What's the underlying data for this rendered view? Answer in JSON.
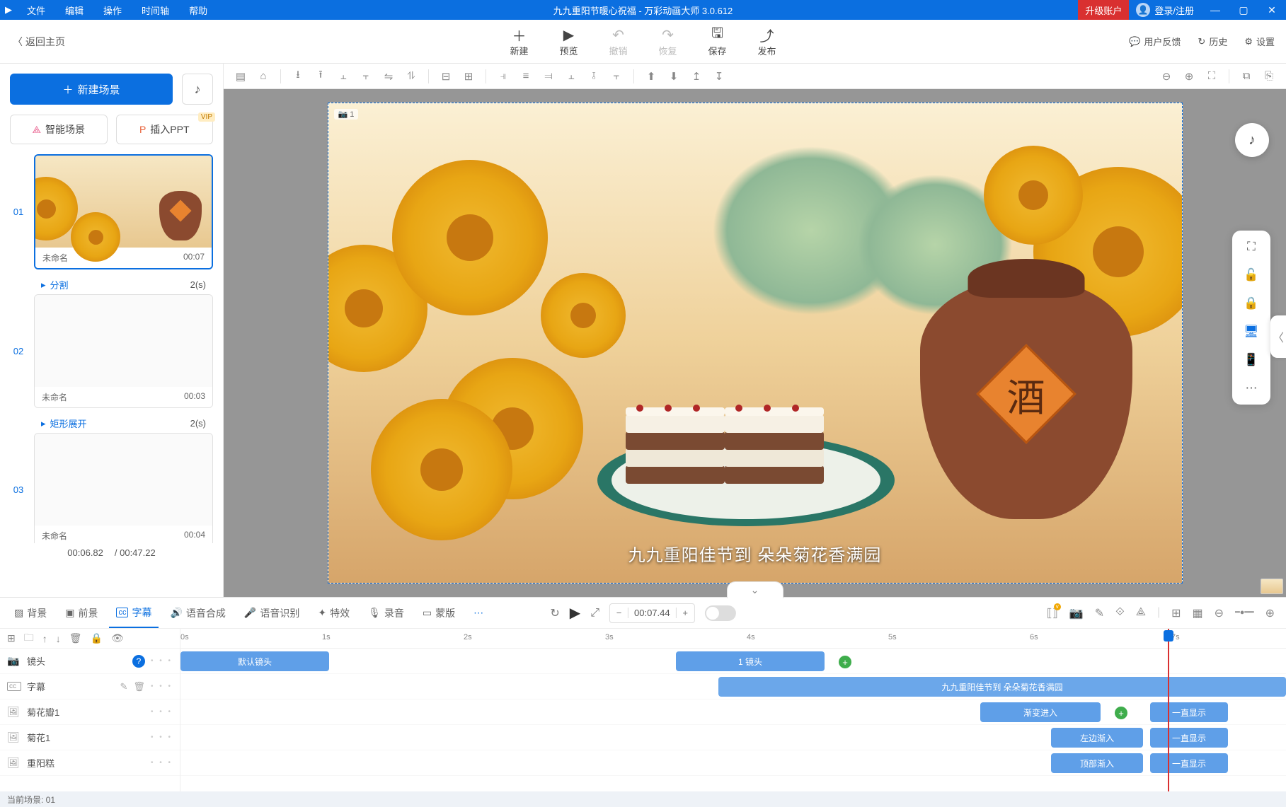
{
  "titlebar": {
    "menus": [
      "文件",
      "编辑",
      "操作",
      "时间轴",
      "帮助"
    ],
    "title": "九九重阳节暖心祝福 - 万彩动画大师 3.0.612",
    "upgrade": "升级账户",
    "login": "登录/注册"
  },
  "maintoolbar": {
    "back": "返回主页",
    "items": [
      {
        "icon": "＋",
        "label": "新建"
      },
      {
        "icon": "▶",
        "label": "预览"
      },
      {
        "icon": "↶",
        "label": "撤销",
        "disabled": true
      },
      {
        "icon": "↷",
        "label": "恢复",
        "disabled": true
      },
      {
        "icon": "🖫",
        "label": "保存"
      },
      {
        "icon": "⤴",
        "label": "发布"
      }
    ],
    "right": [
      {
        "icon": "💬",
        "label": "用户反馈"
      },
      {
        "icon": "↻",
        "label": "历史"
      },
      {
        "icon": "⚙",
        "label": "设置"
      }
    ]
  },
  "sidebar": {
    "newscene": "新建场景",
    "smart": "智能场景",
    "ppt": "插入PPT",
    "vip": "VIP",
    "scenes": [
      {
        "idx": "01",
        "name": "未命名",
        "dur": "00:07",
        "trans": "分割",
        "tdur": "2(s)",
        "active": true,
        "thumb": "main"
      },
      {
        "idx": "02",
        "name": "未命名",
        "dur": "00:03",
        "trans": "矩形展开",
        "tdur": "2(s)",
        "thumb": "white"
      },
      {
        "idx": "03",
        "name": "未命名",
        "dur": "00:04",
        "thumb": "white"
      }
    ],
    "cur": "00:06.82",
    "total": "/ 00:47.22"
  },
  "canvas": {
    "caption": "九九重阳佳节到 朵朵菊花香满园",
    "jar": "酒",
    "camlabel": "1"
  },
  "timeline": {
    "tabs": [
      {
        "icon": "▨",
        "label": "背景"
      },
      {
        "icon": "▣",
        "label": "前景"
      },
      {
        "icon": "cc",
        "label": "字幕",
        "active": true
      },
      {
        "icon": "🔊",
        "label": "语音合成"
      },
      {
        "icon": "🎤",
        "label": "语音识别"
      },
      {
        "icon": "✦",
        "label": "特效"
      },
      {
        "icon": "🎙",
        "label": "录音"
      },
      {
        "icon": "▭",
        "label": "蒙版"
      }
    ],
    "time": "00:07.44",
    "ruler": [
      "0s",
      "1s",
      "2s",
      "3s",
      "4s",
      "5s",
      "6s",
      "7s"
    ],
    "rows": [
      {
        "icon": "📷",
        "name": "镜头",
        "help": true
      },
      {
        "icon": "cc",
        "name": "字幕",
        "extra": true
      },
      {
        "icon": "🖼",
        "name": "菊花瓣1"
      },
      {
        "icon": "🖼",
        "name": "菊花1"
      },
      {
        "icon": "🖼",
        "name": "重阳糕"
      }
    ],
    "clips": {
      "cam_default": "默认镜头",
      "cam_1": "1 镜头",
      "subtitle": "九九重阳佳节到 朵朵菊花香满园",
      "fadein": "渐变进入",
      "always": "一直显示",
      "leftin": "左边渐入",
      "topin": "顶部渐入"
    },
    "status": "当前场景: 01"
  }
}
